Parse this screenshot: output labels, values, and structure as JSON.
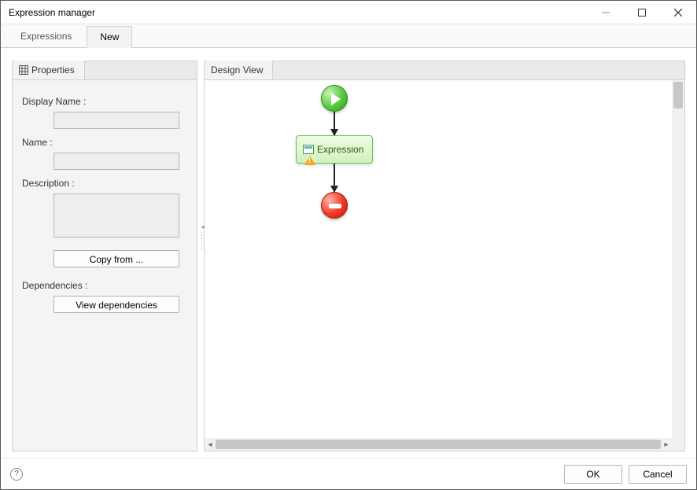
{
  "window": {
    "title": "Expression manager"
  },
  "top_tabs": [
    {
      "label": "Expressions",
      "active": false
    },
    {
      "label": "New",
      "active": true
    }
  ],
  "left_panel": {
    "tab_label": "Properties",
    "display_name_label": "Display Name :",
    "display_name_value": "",
    "name_label": "Name :",
    "name_value": "",
    "description_label": "Description :",
    "description_value": "",
    "copy_from_label": "Copy from ...",
    "dependencies_label": "Dependencies :",
    "view_dependencies_label": "View dependencies"
  },
  "right_panel": {
    "tab_label": "Design View",
    "expression_node_label": "Expression"
  },
  "footer": {
    "help_tooltip": "?",
    "ok_label": "OK",
    "cancel_label": "Cancel"
  }
}
